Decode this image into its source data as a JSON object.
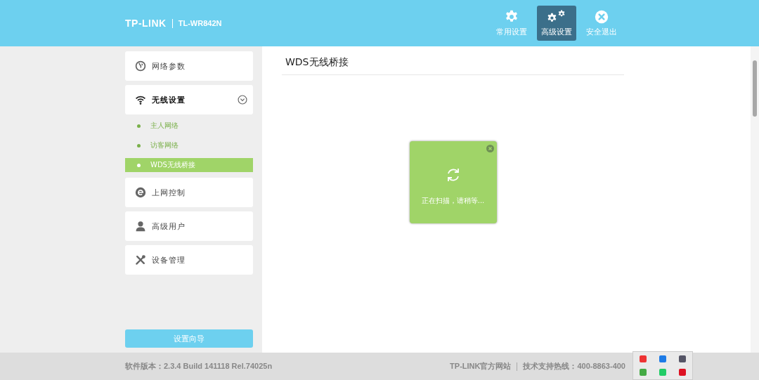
{
  "header": {
    "logo": "TP-LINK",
    "model": "TL-WR842N",
    "nav": [
      {
        "label": "常用设置",
        "selected": false
      },
      {
        "label": "高级设置",
        "selected": true
      },
      {
        "label": "安全退出",
        "selected": false
      }
    ]
  },
  "sidebar": {
    "menu": [
      {
        "label": "网络参数"
      },
      {
        "label": "无线设置",
        "expanded": true,
        "children": [
          {
            "label": "主人网络",
            "selected": false
          },
          {
            "label": "访客网络",
            "selected": false
          },
          {
            "label": "WDS无线桥接",
            "selected": true
          }
        ]
      },
      {
        "label": "上网控制"
      },
      {
        "label": "高级用户"
      },
      {
        "label": "设备管理"
      }
    ],
    "wizard_button": "设置向导"
  },
  "content": {
    "title": "WDS无线桥接",
    "dialog": {
      "message": "正在扫描，请稍等..."
    }
  },
  "footer": {
    "version": "软件版本：2.3.4 Build 141118 Rel.74025n",
    "website_link": "TP-LINK官方网站",
    "hotline": "技术支持热线：400-8863-400"
  }
}
